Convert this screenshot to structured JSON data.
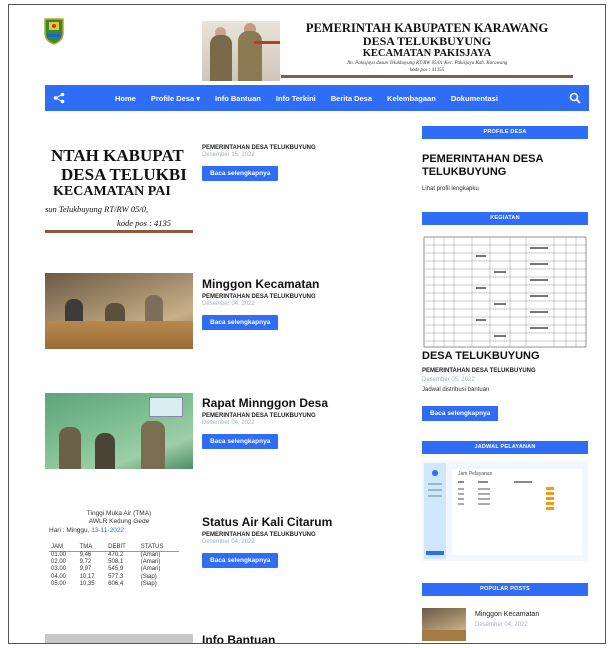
{
  "banner": {
    "line1": "PEMERINTAH KABUPATEN KARAWANG",
    "line2": "DESA TELUKBUYUNG",
    "line3": "KECAMATAN PAKISJAYA",
    "line4": "Jln. Pakisjaya dusun Telukbuyung RT/RW 05/01 Kec. Pakisjaya Kab. Karawang",
    "line5": "kode pos : 41355"
  },
  "nav": {
    "share_icon": "share-icon",
    "items": [
      "Home",
      "Profile Desa ▾",
      "Info Bantuan",
      "Info Terkini",
      "Berita Desa",
      "Kelembagaan",
      "Dokumentasi"
    ],
    "search_icon": "search-icon",
    "color": "#2f6df6"
  },
  "featured": {
    "banner_crop": {
      "a": "NTAH KABUPAT",
      "b": "DESA TELUKBI",
      "c": "KECAMATAN PAI",
      "d": "sun Telukbuyung RT/RW 05/0,",
      "e": "kode pos : 4135"
    },
    "tma": {
      "title1": "Tinggi Muka Air (TMA)",
      "title2": "AWLR Kedung Gede",
      "day_label": "Hari : Minggu,",
      "day_date": "13-11-2022",
      "headers": [
        "JAM",
        "TMA",
        "DEBIT",
        "STATUS"
      ],
      "rows": [
        [
          "01.00",
          "9,46",
          "470,2",
          "(Aman)"
        ],
        [
          "02.00",
          "9,72",
          "508,1",
          "(Aman)"
        ],
        [
          "03.00",
          "9,97",
          "545,9",
          "(Aman)"
        ],
        [
          "04.00",
          "10,17",
          "577,3",
          "(Siap)"
        ],
        [
          "05.00",
          "10,35",
          "606,4",
          "(Siap)"
        ]
      ]
    }
  },
  "posts": [
    {
      "title": "",
      "author": "PEMERINTAHAN DESA TELUKBUYUNG",
      "date": "Desember 15, 2022",
      "button": "Baca selengkapnya"
    },
    {
      "title": "Minggon Kecamatan",
      "author": "PEMERINTAHAN DESA TELUKBUYUNG",
      "date": "Desember 04, 2022",
      "button": "Baca selengkapnya"
    },
    {
      "title": "Rapat Minnggon Desa",
      "author": "PEMERINTAHAN DESA TELUKBUYUNG",
      "date": "Desember 04, 2022",
      "button": "Baca selengkapnya"
    },
    {
      "title": "Status Air Kali Citarum",
      "author": "PEMERINTAHAN DESA TELUKBUYUNG",
      "date": "Desember 04, 2022",
      "button": "Baca selengkapnya"
    },
    {
      "title": "Info Bantuan"
    }
  ],
  "sidebar": {
    "profile": {
      "header": "PROFILE DESA",
      "title": "PEMERINTAHAN DESA TELUKBUYUNG",
      "link": "Lihat profil lengkapku"
    },
    "kegiatan": {
      "header": "KEGIATAN",
      "title": "DESA TELUKBUYUNG",
      "author": "PEMERINTAHAN DESA TELUKBUYUNG",
      "date": "Desember 05, 2022",
      "excerpt": "Jadwal distribusi bantuan",
      "button": "Baca selengkapnya"
    },
    "jadwal": {
      "header": "JADWAL PELAYANAN",
      "image_title": "Jam Pelayanan"
    },
    "popular": {
      "header": "POPULAR POSTS",
      "items": [
        {
          "title": "Minggon Kecamatan",
          "date": "Desember 04, 2022"
        }
      ]
    }
  }
}
